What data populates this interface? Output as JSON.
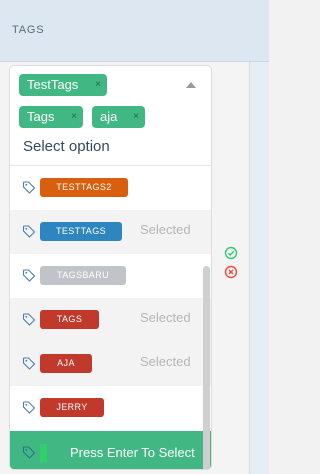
{
  "column": {
    "header": "TAGS"
  },
  "selected_tags": [
    {
      "label": "TestTags"
    },
    {
      "label": "Tags"
    },
    {
      "label": "aja"
    }
  ],
  "tag_remove_symbol": "×",
  "placeholder": "Select option",
  "options": [
    {
      "label": "TESTTAGS2",
      "color": "#d95f0e",
      "selected": false
    },
    {
      "label": "TESTTAGS",
      "color": "#2e86c1",
      "selected": true
    },
    {
      "label": "TAGSBARU",
      "color": "#c0c4c8",
      "selected": false
    },
    {
      "label": "TAGS",
      "color": "#c0392b",
      "selected": true
    },
    {
      "label": "AJA",
      "color": "#c0392b",
      "selected": true
    },
    {
      "label": "JERRY",
      "color": "#c0392b",
      "selected": false
    }
  ],
  "selected_label": "Selected",
  "highlight_hint": "Press Enter To Select",
  "colors": {
    "accent": "#41b883",
    "confirm": "#2ecc71",
    "cancel": "#e74c3c"
  },
  "icons": {
    "option": "tag-icon",
    "confirm": "check-circle-icon",
    "cancel": "x-circle-icon",
    "toggle": "caret-up-icon"
  }
}
